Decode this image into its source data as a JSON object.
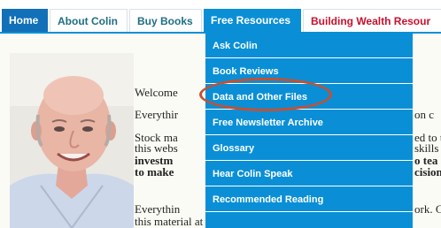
{
  "nav": {
    "home": "Home",
    "about": "About Colin",
    "buy": "Buy Books",
    "free": "Free Resources",
    "wealth": "Building Wealth Resour"
  },
  "dropdown": {
    "items": [
      "Ask Colin",
      "Book Reviews",
      "Data and Other Files",
      "Free Newsletter Archive",
      "Glossary",
      "Hear Colin Speak",
      "Recommended Reading"
    ]
  },
  "content": {
    "welcome": "Welcome",
    "line1_start": "Everythir",
    "line1_end": "on c",
    "line2_start": "Stock ma",
    "line2_end": "ed to t",
    "line3_start": "this webs",
    "line3_end": "skills",
    "line4_start": "investm",
    "line4_end": "o tea",
    "line5_start": "to make",
    "line5_end": "cision",
    "line6_start": "Everythin",
    "line6_end": "ork. C",
    "line7": "this material at no charge. On the members' webs"
  }
}
